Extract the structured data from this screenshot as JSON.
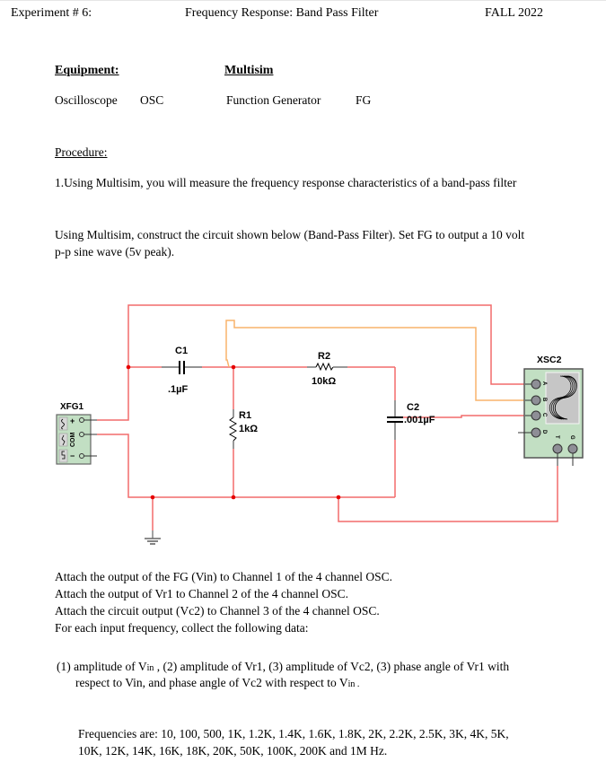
{
  "header": {
    "experiment": "Experiment # 6:",
    "title": "Frequency Response:  Band Pass Filter",
    "term": "FALL 2022"
  },
  "equipment": {
    "heading": "Equipment:",
    "software_heading": "Multisim",
    "items": [
      {
        "name": "Oscilloscope",
        "abbr": "OSC"
      },
      {
        "name": "Function Generator",
        "abbr": "FG"
      }
    ]
  },
  "procedure": {
    "heading": "Procedure:",
    "step1": "1.Using Multisim, you will measure the frequency response characteristics of a band-pass filter",
    "construct_line1": "Using Multisim, construct the circuit shown below (Band-Pass Filter). Set FG to output a 10 volt",
    "construct_line2": "p-p sine wave (5v peak)."
  },
  "circuit": {
    "generator": {
      "label": "XFG1",
      "terminals": [
        "+",
        "COM",
        "−"
      ]
    },
    "scope": {
      "label": "XSC2",
      "channels": [
        "A",
        "B",
        "C",
        "D"
      ],
      "aux": [
        "T",
        "G"
      ]
    },
    "components": [
      {
        "ref": "C1",
        "value": ".1µF"
      },
      {
        "ref": "R2",
        "value": "10kΩ"
      },
      {
        "ref": "R1",
        "value": "1kΩ"
      },
      {
        "ref": "C2",
        "value": ".001µF"
      }
    ],
    "colors": {
      "wire_red": "#f26b6b",
      "wire_orange": "#f9b36b",
      "junction": "#e60000",
      "instrument_fill": "#c2dfc3",
      "screen": "#c6c6c6"
    }
  },
  "attach": [
    "Attach the output of the FG (Vin) to Channel 1 of the 4 channel OSC.",
    "Attach the output of Vr1 to Channel 2 of the 4 channel OSC.",
    "Attach the circuit output (Vc2) to Channel 3 of the 4 channel OSC.",
    "For each input frequency, collect the following data:"
  ],
  "data_list": {
    "line1": {
      "p1": "(1)  amplitude of V",
      "s1": "in",
      "p2": " , (2) amplitude of Vr1, (3) amplitude of Vc2, (3) phase angle of Vr1 with"
    },
    "line2": {
      "p1": "respect to Vin, and phase angle of Vc2 with respect to V",
      "s1": "in",
      "p2": " ."
    }
  },
  "frequencies": {
    "line1": "Frequencies are: 10, 100, 500, 1K, 1.2K, 1.4K, 1.6K, 1.8K, 2K, 2.2K, 2.5K, 3K, 4K, 5K,",
    "line2": "10K, 12K, 14K, 16K, 18K, 20K, 50K, 100K, 200K and 1M Hz."
  }
}
